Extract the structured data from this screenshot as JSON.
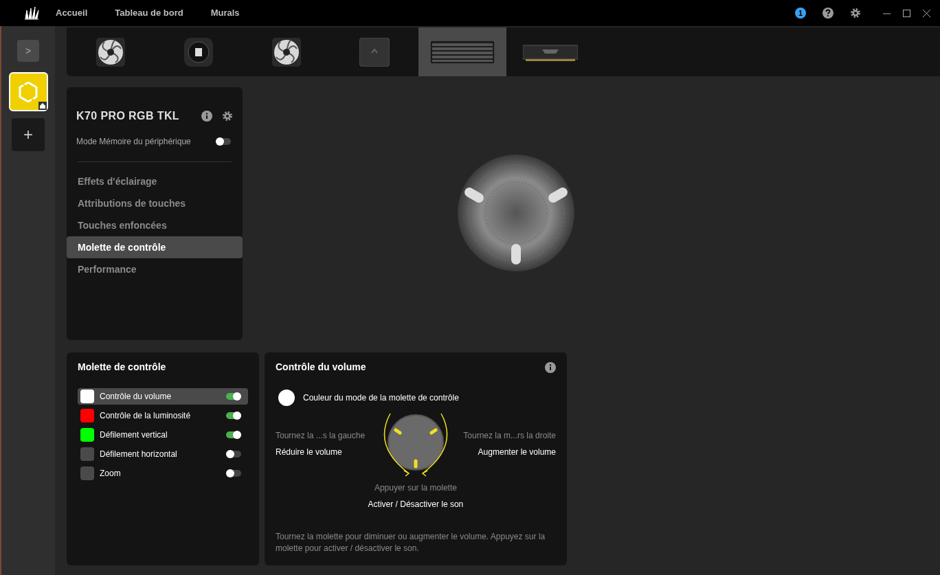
{
  "nav": {
    "tabs": [
      {
        "label": "Accueil",
        "selected": false
      },
      {
        "label": "Tableau de bord",
        "selected": false
      },
      {
        "label": "Murals",
        "selected": false
      }
    ],
    "notification_count": "1"
  },
  "sidebar": {
    "expand": ">",
    "add": "+",
    "profiles": [
      {
        "selected": true,
        "color": "#f0d000"
      }
    ]
  },
  "devices": [
    {
      "kind": "fan",
      "selected": false
    },
    {
      "kind": "lcd",
      "selected": false
    },
    {
      "kind": "fan",
      "selected": false
    },
    {
      "kind": "hub",
      "selected": false
    },
    {
      "kind": "keyboard",
      "selected": true
    },
    {
      "kind": "memory",
      "selected": false
    }
  ],
  "device_panel": {
    "title": "K70 PRO RGB TKL",
    "memory_mode": {
      "label": "Mode Mémoire du périphérique",
      "on": false
    },
    "menu": [
      {
        "label": "Effets d'éclairage",
        "selected": false
      },
      {
        "label": "Attributions de touches",
        "selected": false
      },
      {
        "label": "Touches enfoncées",
        "selected": false
      },
      {
        "label": "Molette de contrôle",
        "selected": true
      },
      {
        "label": "Performance",
        "selected": false
      }
    ]
  },
  "wheel_modes": {
    "title": "Molette de contrôle",
    "items": [
      {
        "label": "Contrôle du volume",
        "color": "#ffffff",
        "selected": true,
        "on": true
      },
      {
        "label": "Contrôle de la luminosité",
        "color": "#ff0000",
        "selected": false,
        "on": true
      },
      {
        "label": "Défilement vertical",
        "color": "#00ff00",
        "selected": false,
        "on": true
      },
      {
        "label": "Défilement horizontal",
        "color": "#4a4a4a",
        "selected": false,
        "on": false
      },
      {
        "label": "Zoom",
        "color": "#4a4a4a",
        "selected": false,
        "on": false
      }
    ]
  },
  "volume_panel": {
    "title": "Contrôle du volume",
    "color": "#ffffff",
    "mode_color_label": "Couleur du mode de la molette de contrôle",
    "left": {
      "hint": "Tournez la ...s la gauche",
      "action": "Réduire le volume"
    },
    "right": {
      "hint": "Tournez la m...rs la droite",
      "action": "Augmenter le volume"
    },
    "press": {
      "hint": "Appuyer sur la molette",
      "action": "Activer / Désactiver le son"
    },
    "description": "Tournez la molette pour diminuer ou augmenter le volume. Appuyez sur la molette pour activer / désactiver le son."
  }
}
